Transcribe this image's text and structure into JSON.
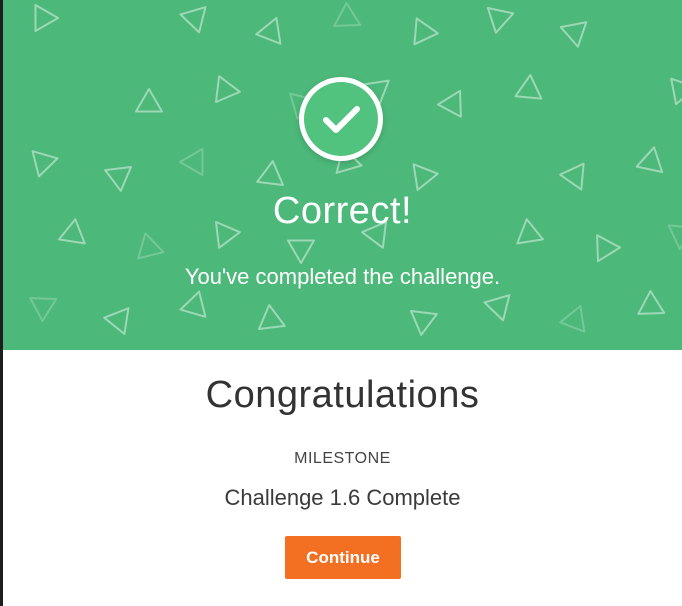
{
  "banner": {
    "title": "Correct!",
    "subtitle": "You've completed the challenge.",
    "icon": "checkmark-icon",
    "color": "#4cb879"
  },
  "body": {
    "heading": "Congratulations",
    "milestone_label": "MILESTONE",
    "milestone_name": "Challenge 1.6 Complete",
    "continue_label": "Continue",
    "button_color": "#f36f21"
  }
}
